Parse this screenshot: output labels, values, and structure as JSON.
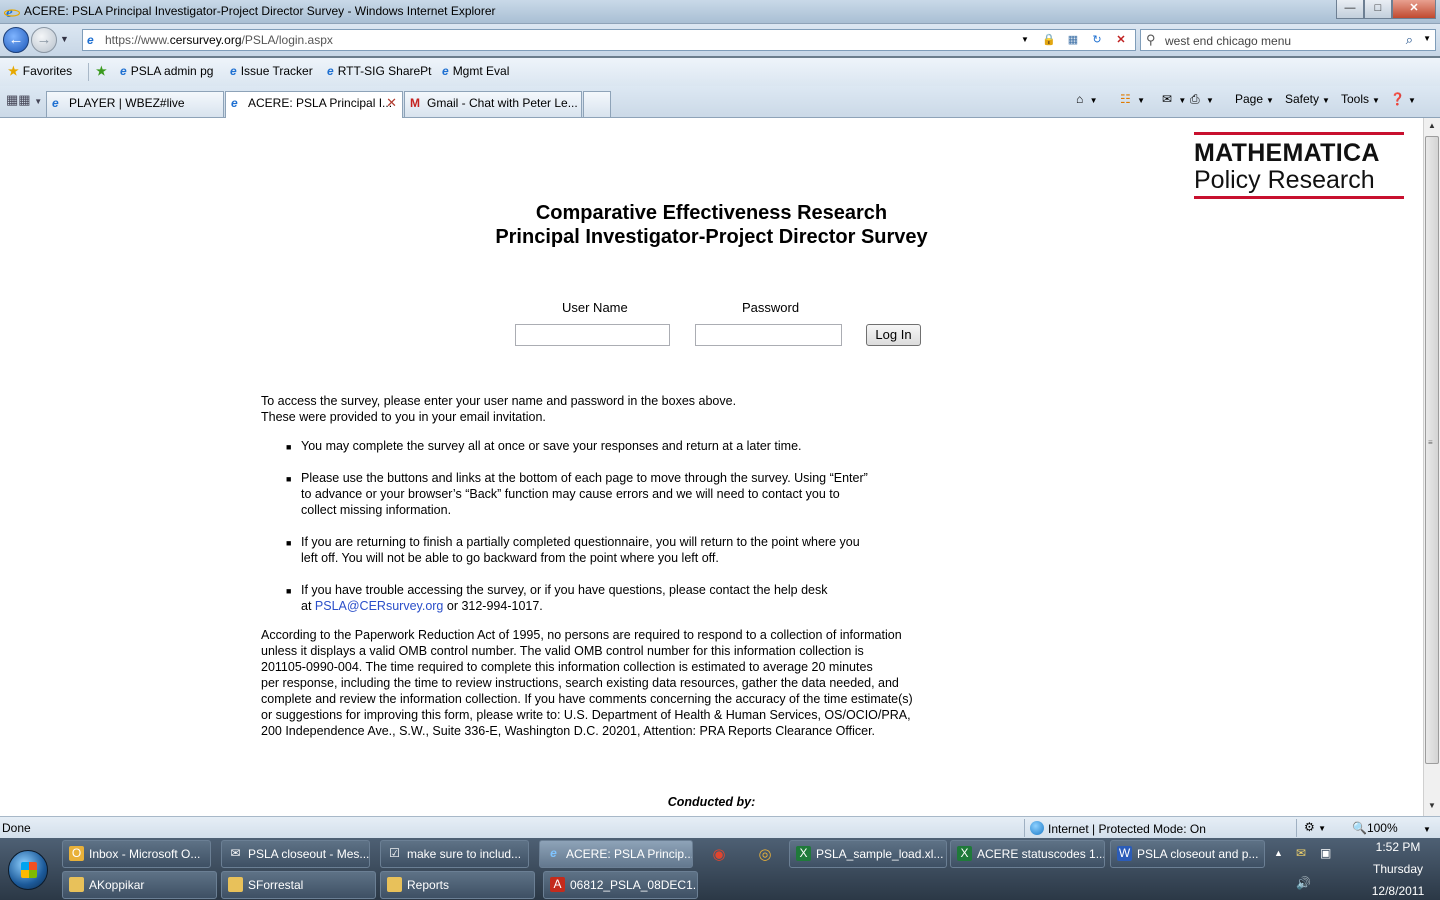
{
  "window": {
    "title": "ACERE: PSLA Principal Investigator-Project Director Survey - Windows Internet Explorer",
    "min": "—",
    "max": "□",
    "close": "✕"
  },
  "address": {
    "url_prefix": "https://www.",
    "url_domain": "cersurvey.org",
    "url_path": "/PSLA/login.aspx",
    "search_text": "west end chicago menu"
  },
  "favorites": {
    "label": "Favorites",
    "items": [
      "PSLA admin pg",
      "Issue Tracker",
      "RTT-SIG SharePt",
      "Mgmt Eval"
    ]
  },
  "tabs": [
    {
      "label": "PLAYER | WBEZ#live",
      "icon": "ie-icon"
    },
    {
      "label": "ACERE: PSLA Principal I...",
      "icon": "ie-icon",
      "active": true
    },
    {
      "label": "Gmail - Chat with Peter Le...",
      "icon": "gmail-icon"
    }
  ],
  "commands": {
    "page": "Page",
    "safety": "Safety",
    "tools": "Tools"
  },
  "page": {
    "logo_line1": "MATHEMATICA",
    "logo_line2": "Policy Research",
    "title_line1": "Comparative Effectiveness Research",
    "title_line2": "Principal Investigator-Project Director Survey",
    "username_label": "User Name",
    "password_label": "Password",
    "login_button": "Log In",
    "intro_line1": "To access the survey, please enter your user name and password in the boxes above.",
    "intro_line2": "These were provided to you in your email invitation.",
    "bullets": [
      [
        "You may complete the survey all at once or save your responses and return at a later time."
      ],
      [
        "Please use the buttons and links at the bottom of each page to move through the survey. Using “Enter”",
        "to advance or your browser’s “Back” function may cause errors and we will need to contact you to",
        "collect missing information."
      ],
      [
        "If you are returning to finish a partially completed questionnaire, you will return to the point where you",
        "left off. You will not be able to go backward from the point where you left off."
      ]
    ],
    "help_line1": "If you have trouble accessing the survey, or if you have questions, please contact the help desk",
    "help_at": "at ",
    "help_email": "PSLA@CERsurvey.org",
    "help_phone": " or 312-994-1017.",
    "paperwork": [
      "According to the Paperwork Reduction Act of 1995, no persons are required to respond to a collection of information",
      "unless it displays a valid OMB control number. The valid OMB control number for this information collection is",
      "201105-0990-004. The time required to complete this information collection is estimated to average 20 minutes",
      "per response, including the time to review instructions, search existing data resources, gather the data needed, and",
      "complete and review the information collection. If you have comments concerning the accuracy of the time estimate(s)",
      "or suggestions for improving this form, please write to: U.S. Department of Health & Human Services, OS/OCIO/PRA,",
      "200 Independence Ave., S.W., Suite 336-E, Washington D.C. 20201, Attention: PRA Reports Clearance Officer."
    ],
    "conducted_by": "Conducted by:"
  },
  "status": {
    "left": "Done",
    "zone": "Internet | Protected Mode: On",
    "zoom": "100%"
  },
  "taskbar": {
    "row1": [
      "Inbox - Microsoft O...",
      "PSLA closeout - Mes...",
      "make sure to includ...",
      "ACERE: PSLA Princip...",
      "PSLA_sample_load.xl...",
      "ACERE statuscodes 1...",
      "PSLA closeout and p..."
    ],
    "row2": [
      "AKoppikar",
      "SForrestal",
      "Reports",
      "06812_PSLA_08DEC1..."
    ],
    "time": "1:52 PM",
    "day": "Thursday",
    "date": "12/8/2011"
  }
}
